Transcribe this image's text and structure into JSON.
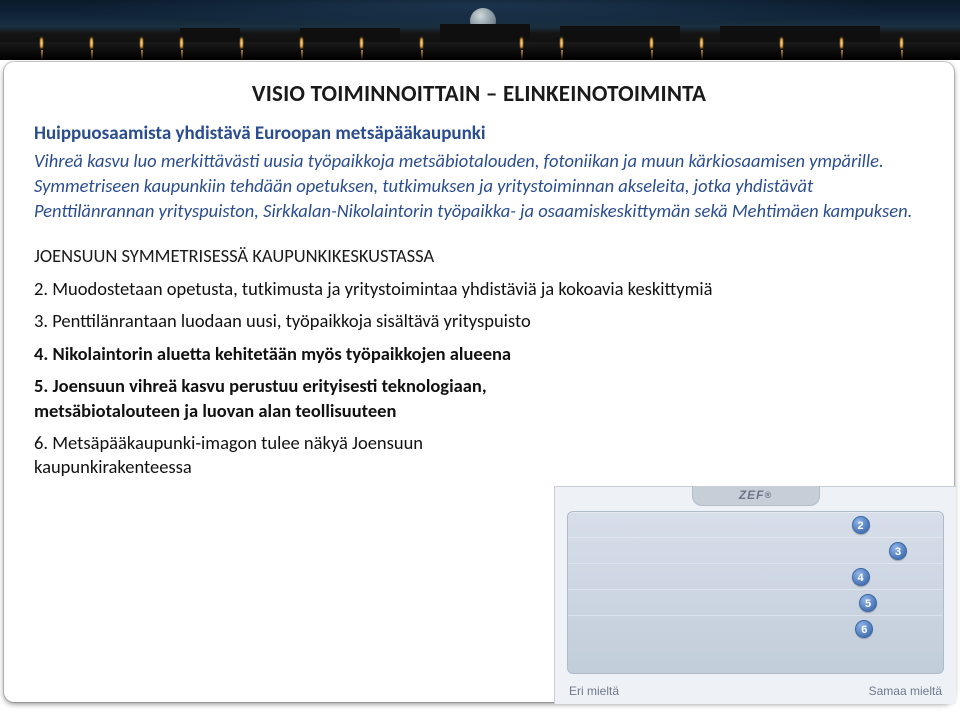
{
  "title": "VISIO TOIMINNOITTAIN – ELINKEINOTOIMINTA",
  "subtitle": "Huippuosaamista yhdistävä Euroopan metsäpääkaupunki",
  "intro": "Vihreä kasvu luo merkittävästi uusia työpaikkoja metsäbiotalouden, fotoniikan ja muun kärkiosaamisen ympärille. Symmetriseen kaupunkiin tehdään opetuksen, tutkimuksen ja yritystoiminnan akseleita, jotka yhdistävät Penttilänrannan yrityspuiston, Sirkkalan-Nikolaintorin työpaikka- ja osaamiskeskittymän sekä Mehtimäen kampuksen.",
  "section_head": "JOENSUUN SYMMETRISESSÄ KAUPUNKIKESKUSTASSA",
  "items": [
    {
      "n": "2.",
      "text": "Muodostetaan opetusta, tutkimusta ja yritystoimintaa yhdistäviä ja kokoavia keskittymiä"
    },
    {
      "n": "3.",
      "text": "Penttilänrantaan luodaan uusi, työpaikkoja sisältävä yrityspuisto"
    },
    {
      "n": "4.",
      "text": "Nikolaintorin aluetta kehitetään myös työpaikkojen alueena"
    },
    {
      "n": "5.",
      "text": "Joensuun vihreä kasvu perustuu erityisesti teknologiaan, metsäbiotalouteen ja luovan alan teollisuuteen"
    },
    {
      "n": "6.",
      "text": "Metsäpääkaupunki-imagon tulee näkyä Joensuun kaupunkirakenteessa"
    }
  ],
  "zef": {
    "brand": "ZEF",
    "left_label": "Eri mieltä",
    "right_label": "Samaa mieltä",
    "nodes": [
      {
        "label": "2",
        "pos": 0.78
      },
      {
        "label": "3",
        "pos": 0.88
      },
      {
        "label": "4",
        "pos": 0.78
      },
      {
        "label": "5",
        "pos": 0.8
      },
      {
        "label": "6",
        "pos": 0.79
      }
    ]
  },
  "banner_lights": [
    40,
    90,
    140,
    180,
    240,
    300,
    360,
    420,
    520,
    560,
    650,
    700,
    780,
    840,
    900
  ]
}
